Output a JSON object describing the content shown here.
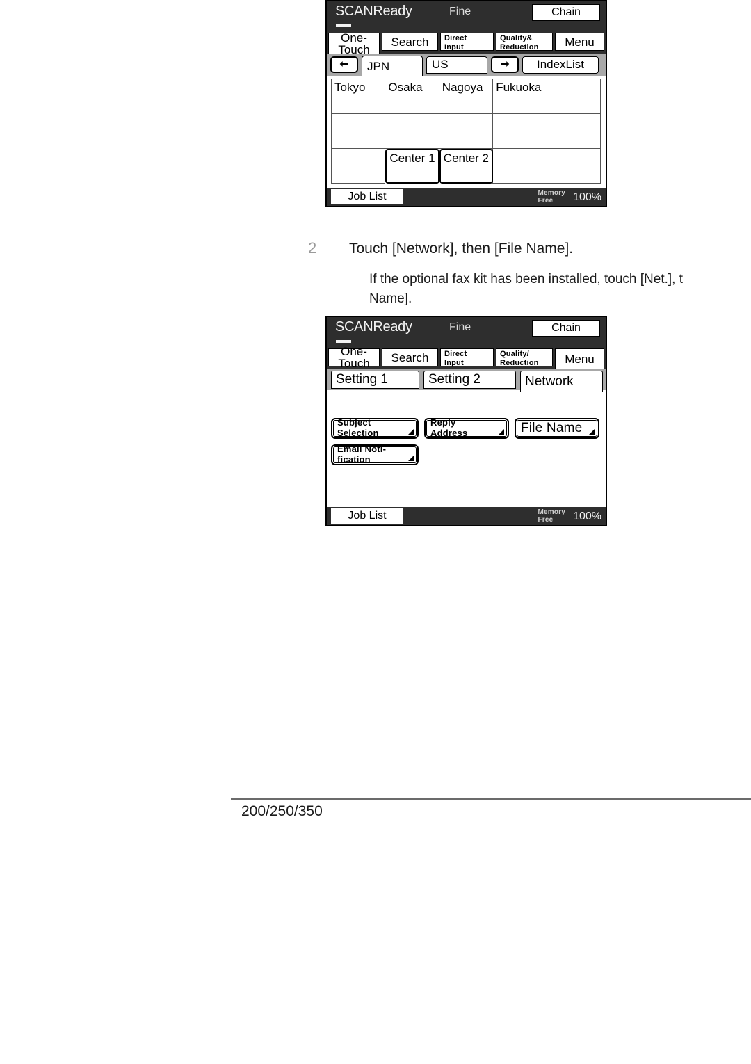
{
  "page": {
    "footer_label": "200/250/350"
  },
  "step": {
    "number": "2",
    "instruction": "Touch [Network], then [File Name].",
    "note": "If the optional fax kit has been installed, touch [Net.], t",
    "note_line2": "Name]."
  },
  "panel1": {
    "title": "SCANReady",
    "mode": "Fine",
    "chain_label": "Chain",
    "tabs": [
      {
        "label": "One-Touch",
        "active": true
      },
      {
        "label": "Search",
        "active": false
      },
      {
        "label_line1": "Direct",
        "label_line2": "Input",
        "active": false
      },
      {
        "label_line1": "Quality&",
        "label_line2": "Reduction",
        "active": false
      },
      {
        "label": "Menu",
        "active": false
      }
    ],
    "nav": {
      "prev_arrow": "⬅",
      "next_arrow": "➡",
      "index_tabs": [
        {
          "label": "JPN",
          "active": true
        },
        {
          "label": "US",
          "active": false
        }
      ],
      "indexlist_label": "IndexList"
    },
    "grid": {
      "columns": 5,
      "rows": 3,
      "cells": [
        {
          "label": "Tokyo",
          "selected": false
        },
        {
          "label": "Osaka",
          "selected": false
        },
        {
          "label": "Nagoya",
          "selected": false
        },
        {
          "label": "Fukuoka",
          "selected": false
        },
        {
          "label": "",
          "selected": false
        },
        {
          "label": "",
          "selected": false
        },
        {
          "label": "",
          "selected": false
        },
        {
          "label": "",
          "selected": false
        },
        {
          "label": "",
          "selected": false
        },
        {
          "label": "",
          "selected": false
        },
        {
          "label": "",
          "selected": false
        },
        {
          "label": "Center 1",
          "selected": true
        },
        {
          "label": "Center 2",
          "selected": true
        },
        {
          "label": "",
          "selected": false
        },
        {
          "label": "",
          "selected": false
        }
      ]
    },
    "status": {
      "joblist_label": "Job List",
      "memory_label_line1": "Memory",
      "memory_label_line2": "Free",
      "memory_value": "100%"
    }
  },
  "panel2": {
    "title": "SCANReady",
    "mode": "Fine",
    "chain_label": "Chain",
    "tabs": [
      {
        "label": "One-Touch",
        "active": false
      },
      {
        "label": "Search",
        "active": false
      },
      {
        "label_line1": "Direct",
        "label_line2": "Input",
        "active": false
      },
      {
        "label_line1": "Quality/",
        "label_line2": "Reduction",
        "active": false
      },
      {
        "label": "Menu",
        "active": true
      }
    ],
    "setting_tabs": [
      {
        "label": "Setting 1",
        "active": false
      },
      {
        "label": "Setting 2",
        "active": false
      },
      {
        "label": "Network",
        "active": true
      }
    ],
    "menu_buttons": [
      {
        "line1": "Subject",
        "line2": "Selection"
      },
      {
        "line1": "Reply",
        "line2": "Address"
      },
      {
        "line1": "File Name",
        "line2": ""
      },
      {
        "line1": "Email Noti-",
        "line2": "fication"
      }
    ],
    "status": {
      "joblist_label": "Job List",
      "memory_label_line1": "Memory",
      "memory_label_line2": "Free",
      "memory_value": "100%"
    }
  }
}
